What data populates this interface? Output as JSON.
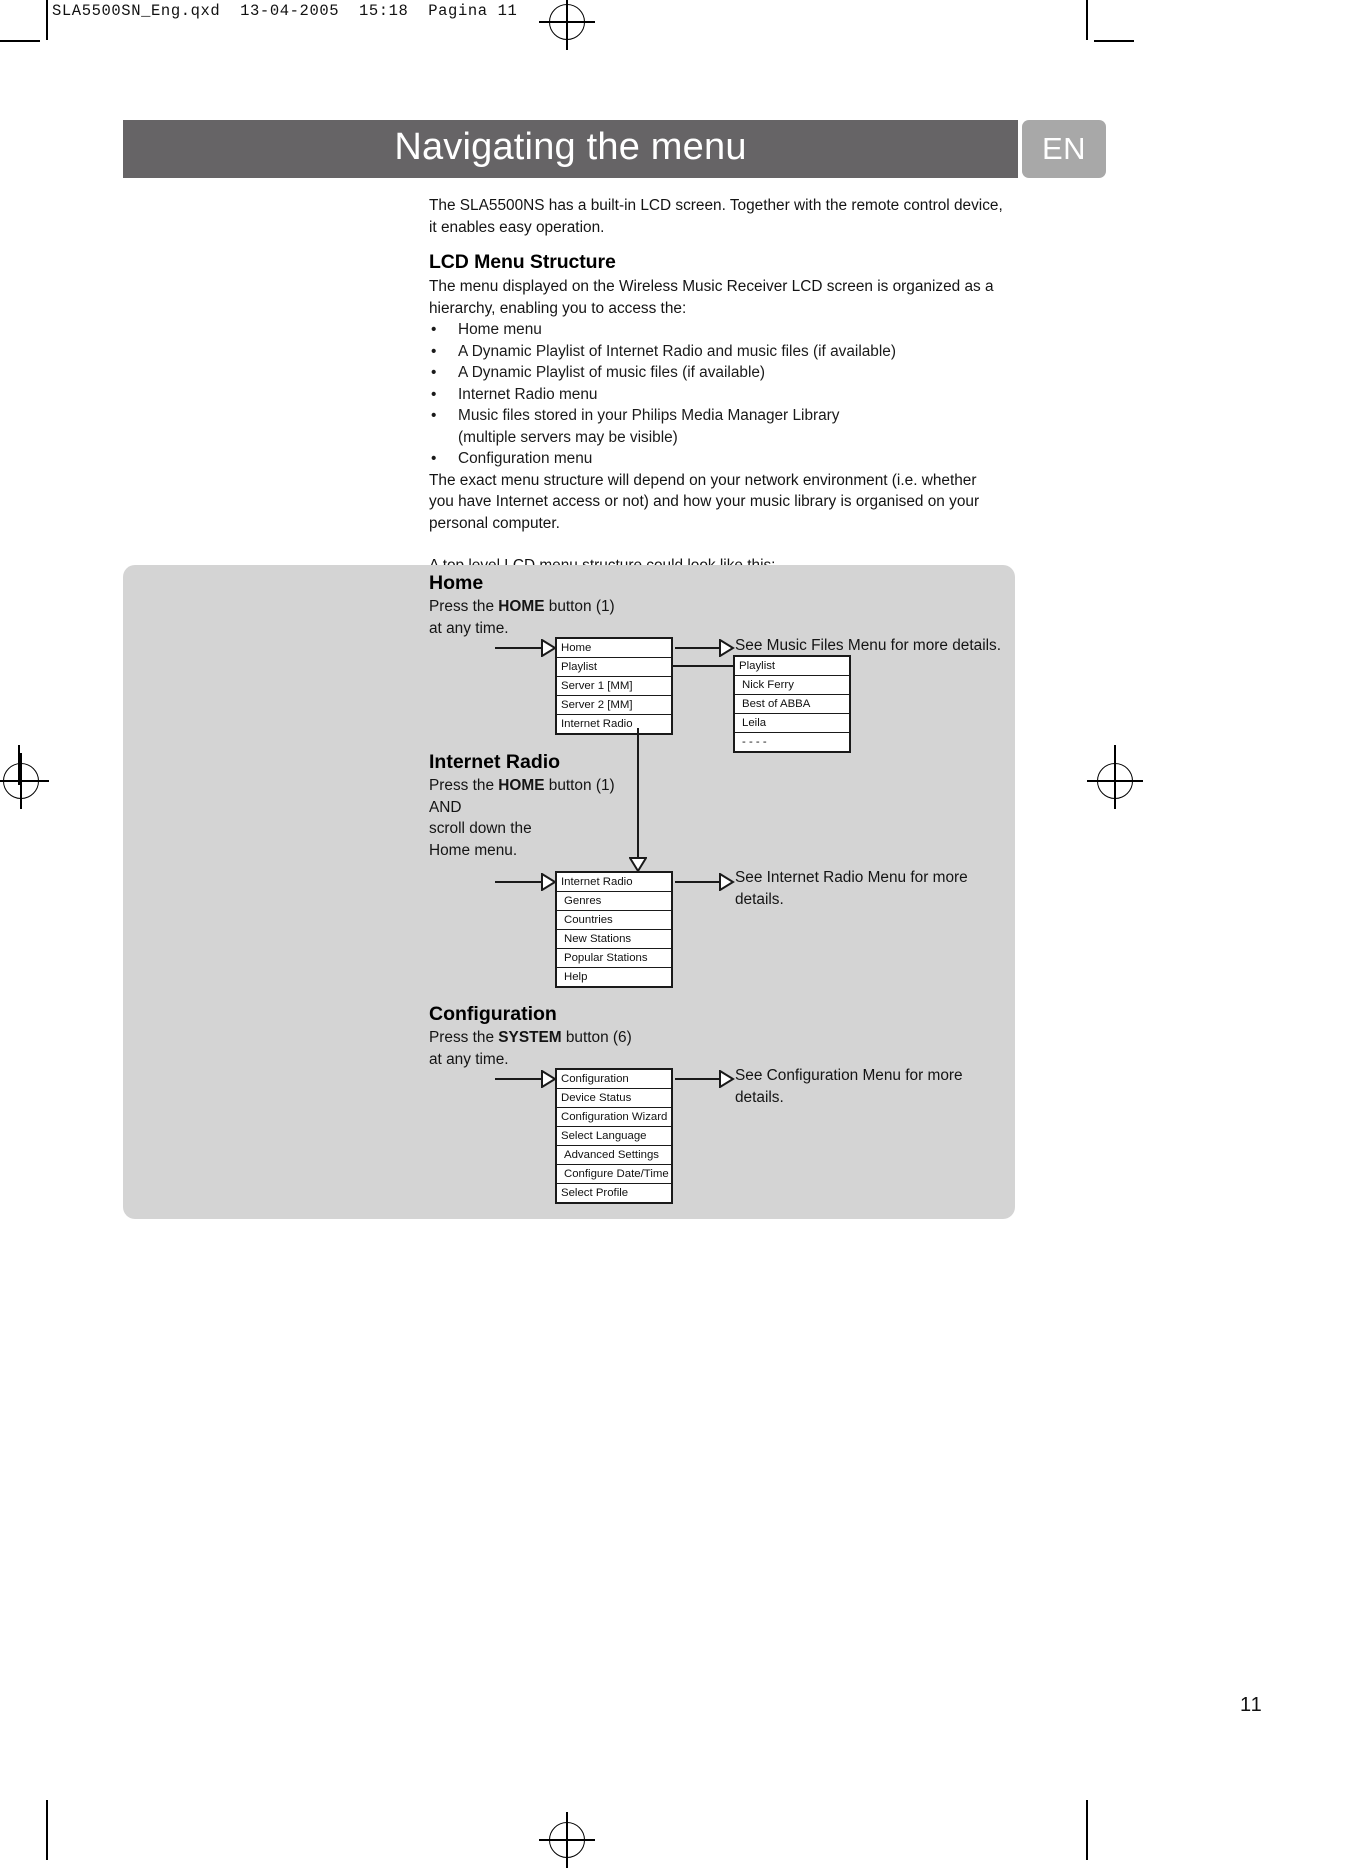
{
  "file_header": "SLA5500SN_Eng.qxd  13-04-2005  15:18  Pagina 11",
  "title": {
    "heading": "Navigating the menu",
    "language_badge": "EN"
  },
  "intro": {
    "line1": "The SLA5500NS has a built-in LCD screen. Together with the remote control device,",
    "line2": " it enables easy operation."
  },
  "lcd_section": {
    "heading": "LCD Menu Structure",
    "para1_line1": "The menu displayed on the Wireless Music Receiver LCD screen is organized as a",
    "para1_line2": "hierarchy, enabling you to access the:",
    "bullets": [
      {
        "text": "Home menu",
        "continuation": ""
      },
      {
        "text": "A Dynamic Playlist of Internet Radio and music files (if available)",
        "continuation": ""
      },
      {
        "text": "A Dynamic Playlist of music files (if available)",
        "continuation": ""
      },
      {
        "text": "Internet Radio menu",
        "continuation": ""
      },
      {
        "text": "Music files stored in your Philips Media Manager Library",
        "continuation": "(multiple servers may be visible)"
      },
      {
        "text": "Configuration menu",
        "continuation": ""
      }
    ],
    "bullet_glyph": "•",
    "para2_line1": "The exact menu structure will depend on your network environment (i.e. whether",
    "para2_line2": "you have Internet access or not) and how your music library is organised on your",
    "para2_line3": "personal computer.",
    "para3": "A top level LCD menu structure could look like this:"
  },
  "diagram": {
    "home": {
      "title": "Home",
      "instruction_prefix": "Press the ",
      "instruction_button": "HOME",
      "instruction_suffix": " button (1)",
      "instruction_line2": "at any time.",
      "menu_items": [
        "Home",
        "Playlist",
        "Server  1  [MM]",
        "Server 2 [MM]",
        "Internet Radio"
      ],
      "callout": "See Music Files Menu for more details.",
      "playlist_items": [
        "Playlist",
        "Nick Ferry",
        "Best of ABBA",
        "Leila",
        "- - - -"
      ]
    },
    "internet_radio": {
      "title": "Internet Radio",
      "instruction_prefix": "Press the ",
      "instruction_button": "HOME",
      "instruction_suffix": " button (1)",
      "instruction_line2": "AND",
      "instruction_line3": "scroll down the",
      "instruction_line4": "Home menu.",
      "menu_items": [
        "Internet Radio",
        "Genres",
        "Countries",
        "New Stations",
        "Popular Stations",
        "Help"
      ],
      "callout_line1": "See Internet Radio Menu for more",
      "callout_line2": "details."
    },
    "configuration": {
      "title": "Configuration",
      "instruction_prefix": "Press the ",
      "instruction_button": "SYSTEM",
      "instruction_suffix": " button (6)",
      "instruction_line2": "at any time.",
      "menu_items": [
        "Configuration",
        "Device  Status",
        "Configuration Wizard",
        "Select Language",
        "Advanced Settings",
        "Configure Date/Time",
        "Select Profile"
      ],
      "callout_line1": "See Configuration Menu for more",
      "callout_line2": "details."
    }
  },
  "page_number": "11",
  "colors": {
    "title_band": "#666466",
    "badge": "#a8a8a8",
    "diagram_panel": "#d4d4d4",
    "text": "#141414"
  }
}
